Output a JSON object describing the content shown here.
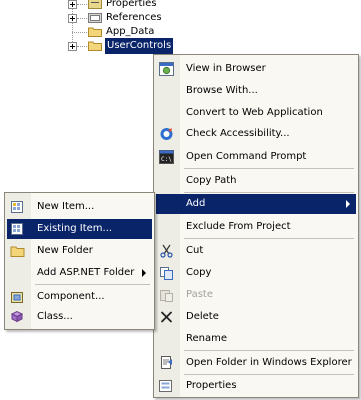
{
  "tree": {
    "nodes": [
      {
        "label": "Properties",
        "icon": "properties-folder-icon"
      },
      {
        "label": "References",
        "icon": "references-folder-icon"
      },
      {
        "label": "App_Data",
        "icon": "folder-icon"
      },
      {
        "label": "UserControls",
        "icon": "folder-icon",
        "selected": true
      }
    ]
  },
  "context_menu": {
    "items": [
      {
        "label": "View in Browser",
        "icon": "view-in-browser-icon"
      },
      {
        "label": "Browse With...",
        "icon": ""
      },
      {
        "label": "Convert to Web Application",
        "icon": ""
      },
      {
        "label": "Check Accessibility...",
        "icon": "accessibility-icon"
      },
      {
        "label": "Open Command Prompt",
        "icon": "command-prompt-icon"
      },
      {
        "label": "Copy Path",
        "icon": ""
      },
      {
        "label": "Add",
        "icon": "",
        "highlighted": true,
        "submenu": true
      },
      {
        "label": "Exclude From Project",
        "icon": ""
      },
      {
        "label": "Cut",
        "icon": "cut-icon"
      },
      {
        "label": "Copy",
        "icon": "copy-icon"
      },
      {
        "label": "Paste",
        "icon": "paste-icon",
        "disabled": true
      },
      {
        "label": "Delete",
        "icon": "delete-icon"
      },
      {
        "label": "Rename",
        "icon": ""
      },
      {
        "label": "Open Folder in Windows Explorer",
        "icon": "open-folder-icon"
      },
      {
        "label": "Properties",
        "icon": "properties-icon"
      }
    ]
  },
  "add_submenu": {
    "items": [
      {
        "label": "New Item...",
        "icon": "new-item-icon"
      },
      {
        "label": "Existing Item...",
        "icon": "existing-item-icon",
        "highlighted": true
      },
      {
        "label": "New Folder",
        "icon": "new-folder-icon"
      },
      {
        "label": "Add ASP.NET Folder",
        "icon": "",
        "submenu": true
      },
      {
        "label": "Component...",
        "icon": "component-icon"
      },
      {
        "label": "Class...",
        "icon": "class-icon"
      }
    ]
  },
  "colors": {
    "highlight": "#0a246a",
    "menu_background": "#f9f8f3",
    "gutter": "#eeede5",
    "disabled_text": "#a4a29a"
  }
}
